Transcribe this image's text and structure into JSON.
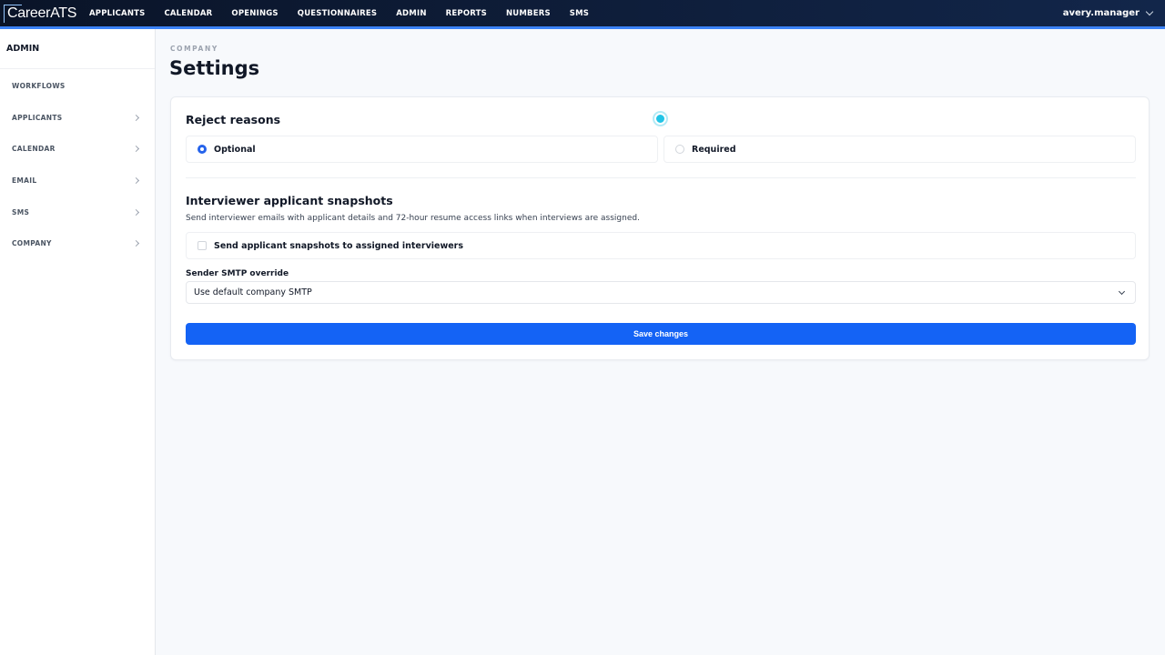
{
  "app": {
    "logo": "CareerATS"
  },
  "topnav": {
    "items": [
      "APPLICANTS",
      "CALENDAR",
      "OPENINGS",
      "QUESTIONNAIRES",
      "ADMIN",
      "REPORTS",
      "NUMBERS",
      "SMS"
    ],
    "user": "avery.manager"
  },
  "sidebar": {
    "title": "ADMIN",
    "items": [
      {
        "label": "WORKFLOWS"
      },
      {
        "label": "APPLICANTS"
      },
      {
        "label": "CALENDAR"
      },
      {
        "label": "EMAIL"
      },
      {
        "label": "SMS"
      },
      {
        "label": "COMPANY"
      }
    ]
  },
  "page": {
    "breadcrumb": "COMPANY",
    "title": "Settings"
  },
  "reject_reasons": {
    "title": "Reject reasons",
    "options": [
      {
        "label": "Optional",
        "selected": true
      },
      {
        "label": "Required",
        "selected": false
      }
    ]
  },
  "snapshots": {
    "title": "Interviewer applicant snapshots",
    "description": "Send interviewer emails with applicant details and 72-hour resume access links when interviews are assigned.",
    "checkbox_label": "Send applicant snapshots to assigned interviewers",
    "checkbox_checked": false,
    "smtp_label": "Sender SMTP override",
    "smtp_value": "Use default company SMTP"
  },
  "actions": {
    "save_label": "Save changes"
  },
  "colors": {
    "accent": "#1463f5",
    "nav_bg": "#0a1428",
    "cursor": "#22c4e6"
  }
}
